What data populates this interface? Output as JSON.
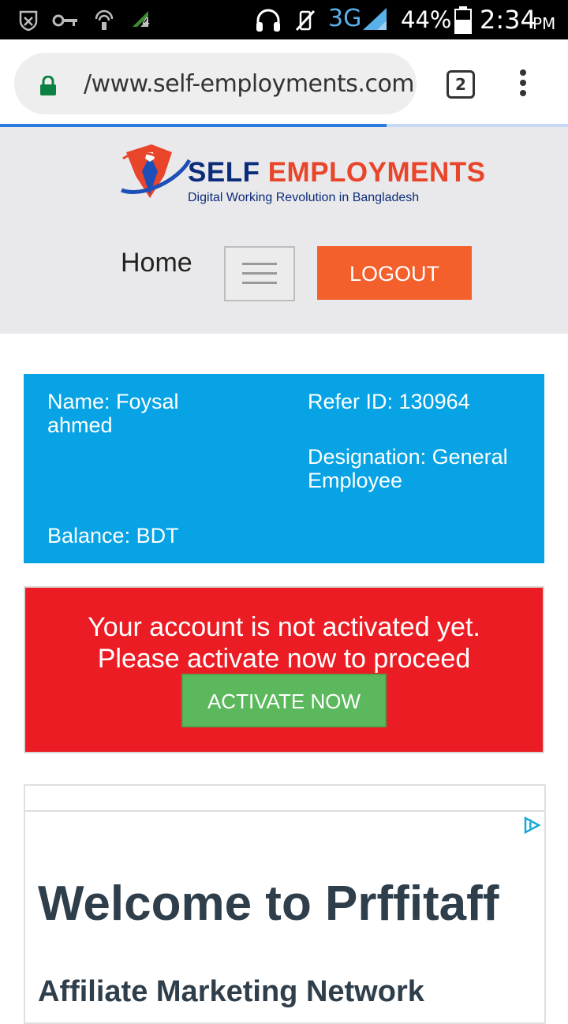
{
  "status_bar": {
    "network": "3G",
    "battery": "44%",
    "time": "2:34",
    "ampm": "PM",
    "notif_count": "4"
  },
  "browser": {
    "url": "/www.self-employments.com",
    "tab_count": "2",
    "load_progress": 0.68
  },
  "site": {
    "logo_word1": "SELF",
    "logo_word2": "EMPLOYMENTS",
    "tagline": "Digital Working Revolution in Bangladesh",
    "nav_home": "Home",
    "logout_label": "LOGOUT"
  },
  "account": {
    "name_line1": "Name: Foysal",
    "name_line2": "ahmed",
    "refer_id": "Refer ID: 130964",
    "designation_line1": "Designation: General",
    "designation_line2": "Employee",
    "balance": "Balance: BDT"
  },
  "alert": {
    "line1": "Your account is not activated yet.",
    "line2": "Please activate now to proceed",
    "button": "ACTIVATE NOW"
  },
  "ad": {
    "heading": "Welcome to Prffitaff",
    "subheading": "Affiliate Marketing Network"
  },
  "colors": {
    "header_bg": "#e9e9eb",
    "logout_orange": "#f4602c",
    "info_blue": "#07a3e5",
    "alert_red": "#ec1c24",
    "activate_green": "#5cb85c"
  }
}
